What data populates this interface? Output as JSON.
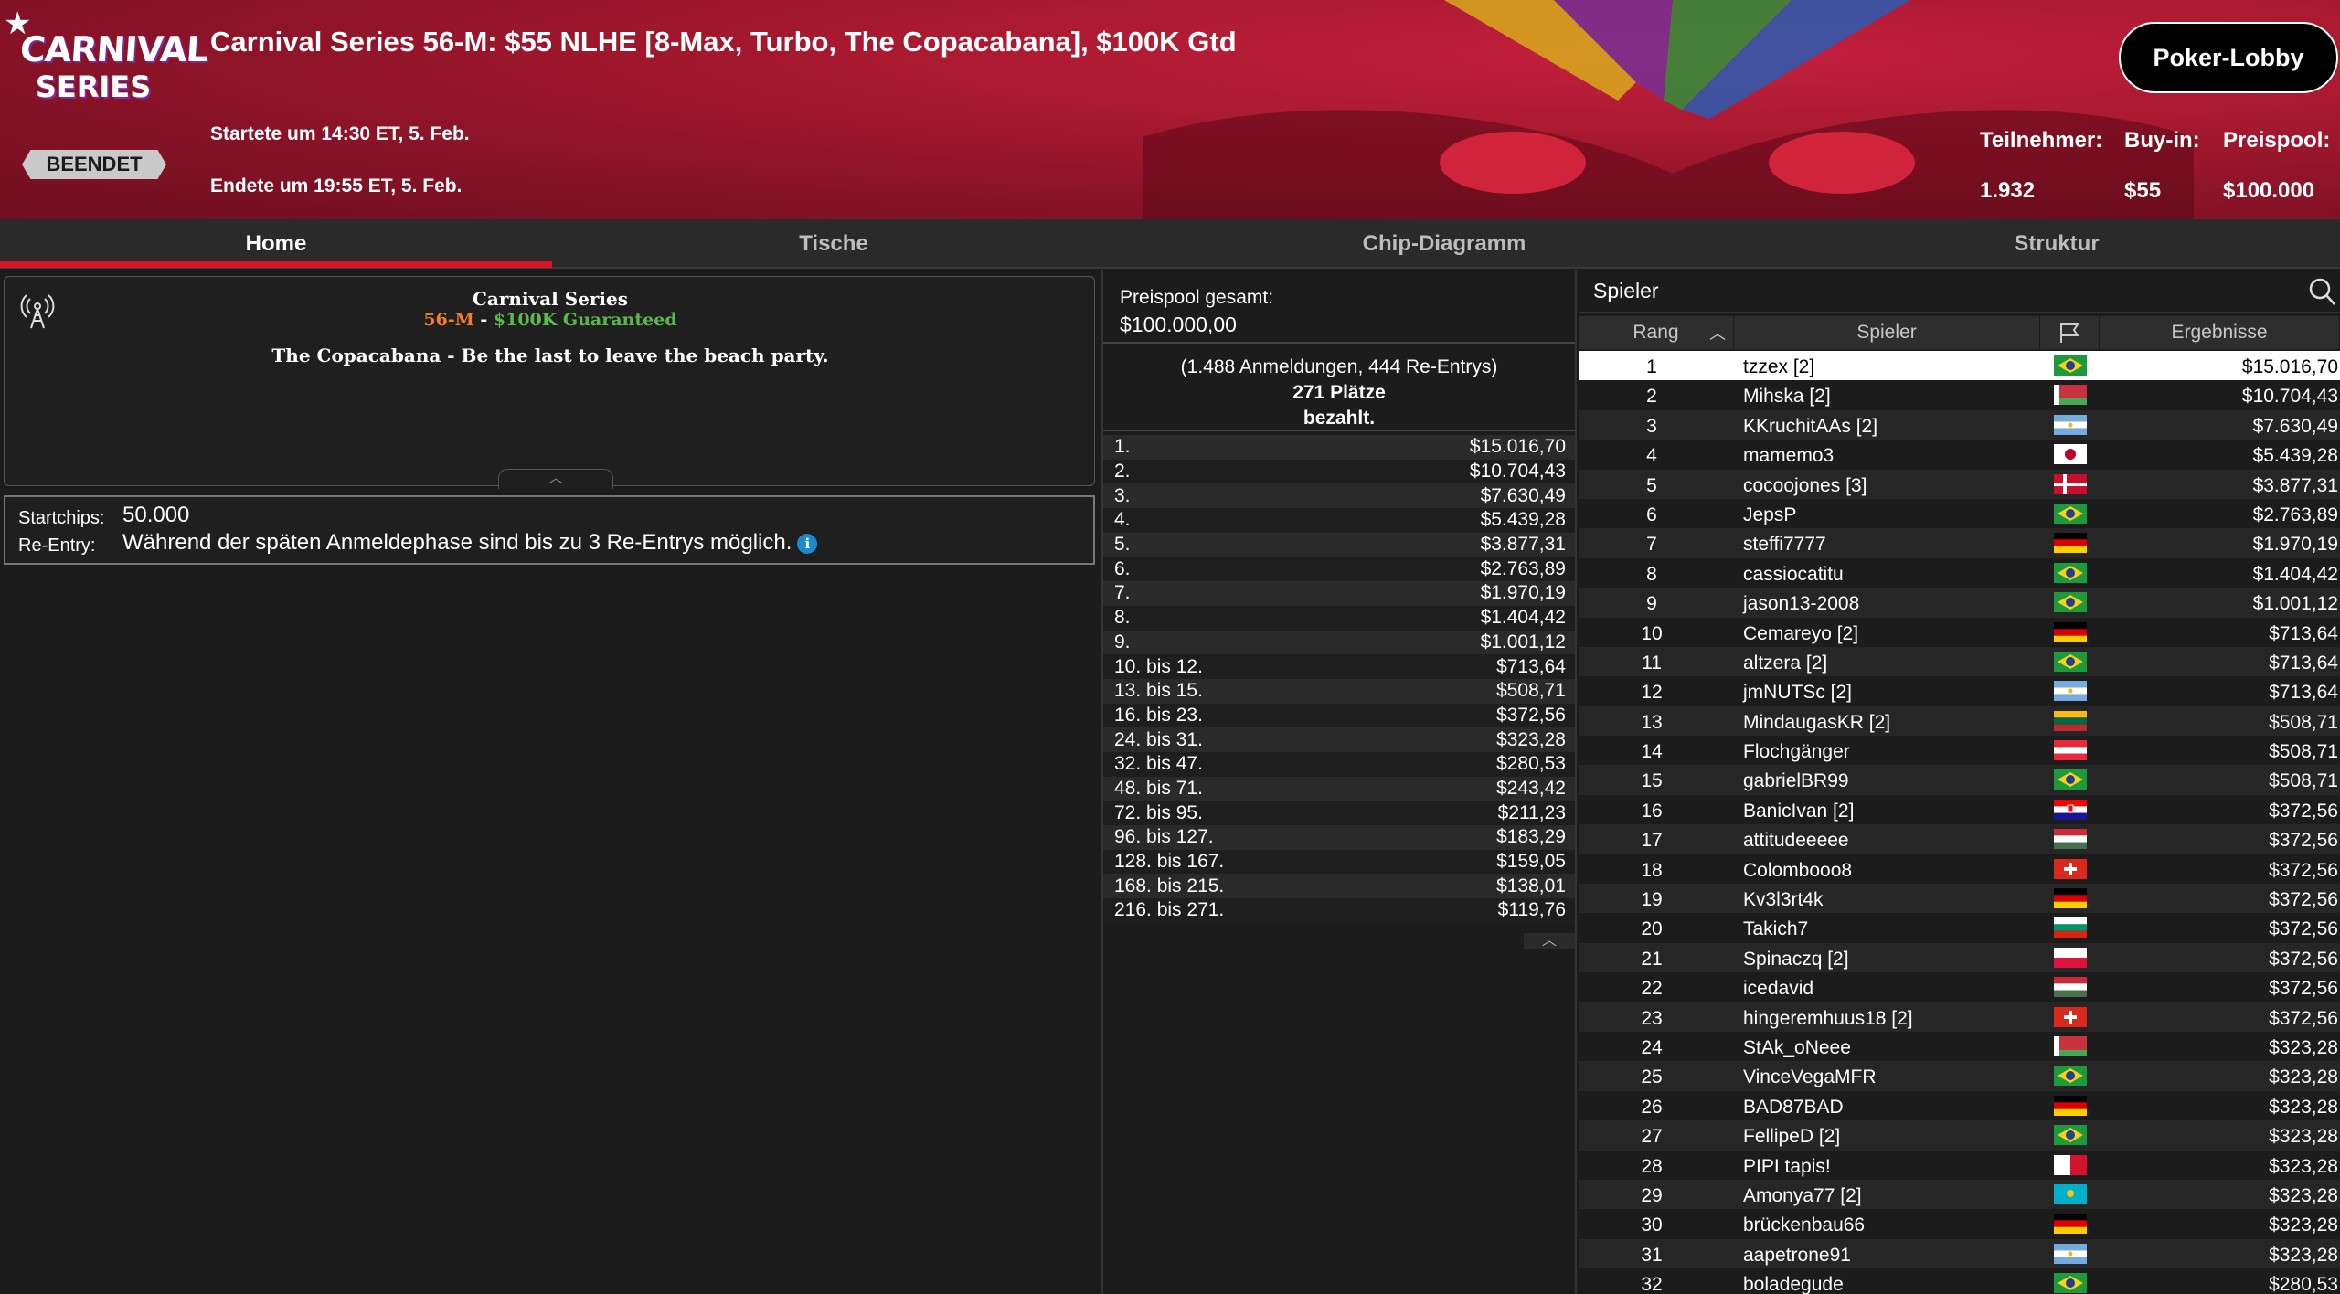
{
  "header": {
    "logo_line1": "CARNIVAL",
    "logo_line2": "SERIES",
    "status": "BEENDET",
    "title": "Carnival Series 56-M: $55 NLHE [8-Max, Turbo, The Copacabana], $100K Gtd",
    "start": "Startete um 14:30 ET, 5. Feb.",
    "end": "Endete um 19:55 ET, 5. Feb.",
    "lobby_button": "Poker-Lobby",
    "stats": [
      {
        "label": "Teilnehmer:",
        "value": "1.932"
      },
      {
        "label": "Buy-in:",
        "value": "$55"
      },
      {
        "label": "Preispool:",
        "value": "$100.000"
      }
    ]
  },
  "tabs": [
    "Home",
    "Tische",
    "Chip-Diagramm",
    "Struktur"
  ],
  "info": {
    "series_name": "Carnival Series",
    "series_code": "56-M",
    "series_sep": " - ",
    "series_gtd": "$100K Guaranteed",
    "description": "The Copacabana - Be the last to leave the beach party.",
    "startchips_label": "Startchips:",
    "startchips_value": "50.000",
    "reentry_label": "Re-Entry:",
    "reentry_value": "Während der späten Anmeldephase sind bis zu 3 Re-Entrys möglich."
  },
  "prizepool": {
    "label": "Preispool gesamt:",
    "total": "$100.000,00",
    "entries_line": "(1.488 Anmeldungen, 444 Re-Entrys)",
    "paid_line1": "271 Plätze",
    "paid_line2": "bezahlt.",
    "payouts": [
      [
        "1.",
        "$15.016,70"
      ],
      [
        "2.",
        "$10.704,43"
      ],
      [
        "3.",
        "$7.630,49"
      ],
      [
        "4.",
        "$5.439,28"
      ],
      [
        "5.",
        "$3.877,31"
      ],
      [
        "6.",
        "$2.763,89"
      ],
      [
        "7.",
        "$1.970,19"
      ],
      [
        "8.",
        "$1.404,42"
      ],
      [
        "9.",
        "$1.001,12"
      ],
      [
        "10. bis 12.",
        "$713,64"
      ],
      [
        "13. bis 15.",
        "$508,71"
      ],
      [
        "16. bis 23.",
        "$372,56"
      ],
      [
        "24. bis 31.",
        "$323,28"
      ],
      [
        "32. bis 47.",
        "$280,53"
      ],
      [
        "48. bis 71.",
        "$243,42"
      ],
      [
        "72. bis 95.",
        "$211,23"
      ],
      [
        "96. bis 127.",
        "$183,29"
      ],
      [
        "128. bis 167.",
        "$159,05"
      ],
      [
        "168. bis 215.",
        "$138,01"
      ],
      [
        "216. bis 271.",
        "$119,76"
      ]
    ]
  },
  "players": {
    "title": "Spieler",
    "columns": {
      "rank": "Rang",
      "player": "Spieler",
      "result": "Ergebnisse"
    },
    "rows": [
      {
        "rank": "1",
        "name": "tzzex [2]",
        "flag": "BR",
        "amount": "$15.016,70"
      },
      {
        "rank": "2",
        "name": "Mihska [2]",
        "flag": "BY",
        "amount": "$10.704,43"
      },
      {
        "rank": "3",
        "name": "KKruchitAAs [2]",
        "flag": "AR",
        "amount": "$7.630,49"
      },
      {
        "rank": "4",
        "name": "mamemo3",
        "flag": "JP",
        "amount": "$5.439,28"
      },
      {
        "rank": "5",
        "name": "cocoojones [3]",
        "flag": "DK",
        "amount": "$3.877,31"
      },
      {
        "rank": "6",
        "name": "JepsP",
        "flag": "BR",
        "amount": "$2.763,89"
      },
      {
        "rank": "7",
        "name": "steffi7777",
        "flag": "DE",
        "amount": "$1.970,19"
      },
      {
        "rank": "8",
        "name": "cassiocatitu",
        "flag": "BR",
        "amount": "$1.404,42"
      },
      {
        "rank": "9",
        "name": "jason13-2008",
        "flag": "BR",
        "amount": "$1.001,12"
      },
      {
        "rank": "10",
        "name": "Cemareyo [2]",
        "flag": "DE",
        "amount": "$713,64"
      },
      {
        "rank": "11",
        "name": "altzera [2]",
        "flag": "BR",
        "amount": "$713,64"
      },
      {
        "rank": "12",
        "name": "jmNUTSc [2]",
        "flag": "AR",
        "amount": "$713,64"
      },
      {
        "rank": "13",
        "name": "MindaugasKR [2]",
        "flag": "LT",
        "amount": "$508,71"
      },
      {
        "rank": "14",
        "name": "Flochgänger",
        "flag": "AT",
        "amount": "$508,71"
      },
      {
        "rank": "15",
        "name": "gabrielBR99",
        "flag": "BR",
        "amount": "$508,71"
      },
      {
        "rank": "16",
        "name": "BanicIvan [2]",
        "flag": "HR",
        "amount": "$372,56"
      },
      {
        "rank": "17",
        "name": "attitudeeeee",
        "flag": "HU",
        "amount": "$372,56"
      },
      {
        "rank": "18",
        "name": "Colombooo8",
        "flag": "CH",
        "amount": "$372,56"
      },
      {
        "rank": "19",
        "name": "Kv3l3rt4k",
        "flag": "DE",
        "amount": "$372,56"
      },
      {
        "rank": "20",
        "name": "Takich7",
        "flag": "BG",
        "amount": "$372,56"
      },
      {
        "rank": "21",
        "name": "Spinaczq [2]",
        "flag": "PL",
        "amount": "$372,56"
      },
      {
        "rank": "22",
        "name": "icedavid",
        "flag": "HU",
        "amount": "$372,56"
      },
      {
        "rank": "23",
        "name": "hingeremhuus18 [2]",
        "flag": "CH",
        "amount": "$372,56"
      },
      {
        "rank": "24",
        "name": "StAk_oNeee",
        "flag": "BY",
        "amount": "$323,28"
      },
      {
        "rank": "25",
        "name": "VinceVegaMFR",
        "flag": "BR",
        "amount": "$323,28"
      },
      {
        "rank": "26",
        "name": "BAD87BAD",
        "flag": "DE",
        "amount": "$323,28"
      },
      {
        "rank": "27",
        "name": "FellipeD [2]",
        "flag": "BR",
        "amount": "$323,28"
      },
      {
        "rank": "28",
        "name": "PIPI tapis!",
        "flag": "MT",
        "amount": "$323,28"
      },
      {
        "rank": "29",
        "name": "Amonya77 [2]",
        "flag": "KZ",
        "amount": "$323,28"
      },
      {
        "rank": "30",
        "name": "brückenbau66",
        "flag": "DE",
        "amount": "$323,28"
      },
      {
        "rank": "31",
        "name": "aapetrone91",
        "flag": "AR",
        "amount": "$323,28"
      },
      {
        "rank": "32",
        "name": "boladegude",
        "flag": "BR",
        "amount": "$280,53"
      }
    ]
  },
  "colors": {
    "accent": "#d8142b",
    "series_code": "#f07f2a",
    "series_gtd": "#5bb84e",
    "info_icon": "#1b8acb"
  }
}
